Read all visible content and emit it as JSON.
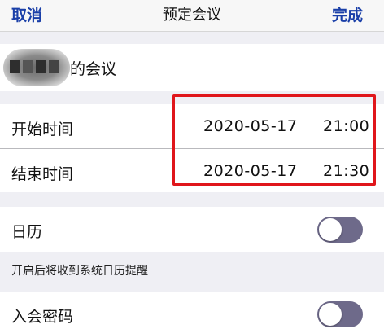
{
  "navbar": {
    "cancel_label": "取消",
    "title": "预定会议",
    "done_label": "完成"
  },
  "meeting_name": {
    "suffix": "的会议"
  },
  "start_time": {
    "label": "开始时间",
    "date": "2020-05-17",
    "time": "21:00"
  },
  "end_time": {
    "label": "结束时间",
    "date": "2020-05-17",
    "time": "21:30"
  },
  "calendar": {
    "label": "日历",
    "note": "开启后将收到系统日历提醒",
    "enabled": false
  },
  "password": {
    "label": "入会密码",
    "enabled": false
  },
  "colors": {
    "accent": "#1a3fa8",
    "toggle_off_track": "#6e6a8a",
    "highlight": "#e0161b"
  }
}
